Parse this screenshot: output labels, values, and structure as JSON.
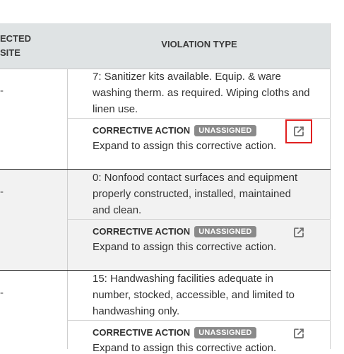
{
  "header": {
    "left_col_label_line1": "ECTED",
    "left_col_label_line2": "SITE",
    "violation_type_label": "VIOLATION TYPE"
  },
  "rows": [
    {
      "dash": "-",
      "violation": "7: Sanitizer kits available. Equip. & ware washing therm. as required. Wiping cloths and linen use.",
      "ca_label": "CORRECTIVE ACTION",
      "ca_badge": "UNASSIGNED",
      "ca_desc": "Expand to assign this corrective action.",
      "icon": "external-link-icon"
    },
    {
      "dash": "-",
      "violation": "0: Nonfood contact surfaces and equipment properly constructed, installed, maintained and clean.",
      "ca_label": "CORRECTIVE ACTION",
      "ca_badge": "UNASSIGNED",
      "ca_desc": "Expand to assign this corrective action.",
      "icon": "external-link-icon"
    },
    {
      "dash": "-",
      "violation": "15: Handwashing facilities adequate in number, stocked, accessible, and limited to handwashing only.",
      "ca_label": "CORRECTIVE ACTION",
      "ca_badge": "UNASSIGNED",
      "ca_desc": "Expand to assign this corrective action.",
      "icon": "external-link-icon"
    }
  ],
  "colors": {
    "header_bg": "#dfe3e4",
    "row_alt_bg": "#f2f2f2",
    "badge_bg": "#8a8a8a",
    "focus_outline": "#e02020",
    "icon_color": "#6d6d6d"
  }
}
